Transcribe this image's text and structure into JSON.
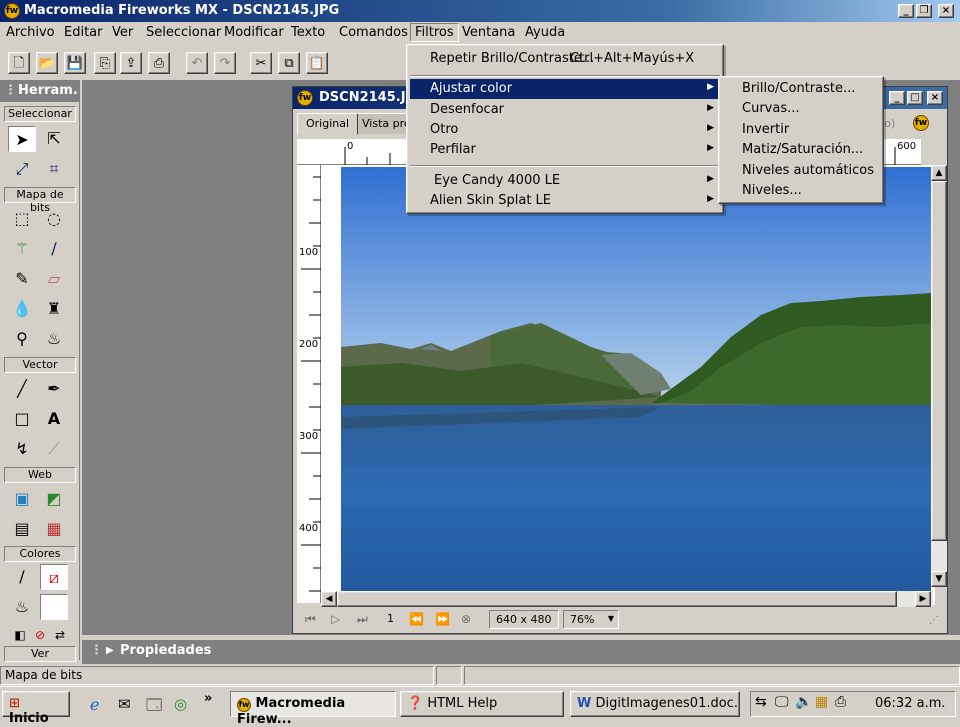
{
  "app": {
    "title": "Macromedia Fireworks MX - DSCN2145.JPG",
    "icon": "fireworks-logo-icon"
  },
  "menubar": [
    "Archivo",
    "Editar",
    "Ver",
    "Seleccionar",
    "Modificar",
    "Texto",
    "Comandos",
    "Filtros",
    "Ventana",
    "Ayuda"
  ],
  "toolbar": {
    "icons": [
      "new-file-icon",
      "open-file-icon",
      "save-icon",
      "import-icon",
      "export-icon",
      "print-icon",
      "undo-icon",
      "redo-icon",
      "cut-icon",
      "copy-icon",
      "paste-icon"
    ]
  },
  "tools_panel": {
    "title": "Herram.",
    "sections": [
      "Seleccionar",
      "Mapa de bits",
      "Vector",
      "Web",
      "Colores",
      "Ver"
    ]
  },
  "document": {
    "title": "DSCN2145.JPG",
    "tabs": [
      "Original",
      "Vista prev"
    ],
    "tab_partial_right": "nto)",
    "hruler_labels": [
      "0",
      "600"
    ],
    "vruler_labels": [
      "100",
      "200",
      "300",
      "400"
    ],
    "page_number": "1",
    "size": "640 x 480",
    "zoom": "76%"
  },
  "filtros_menu": {
    "items": [
      {
        "label": "Repetir Brillo/Contraste...",
        "shortcut": "Ctrl+Alt+Mayús+X"
      },
      {
        "label": "Ajustar color",
        "submenu": true,
        "highlighted": true
      },
      {
        "label": "Desenfocar",
        "submenu": true
      },
      {
        "label": "Otro",
        "submenu": true
      },
      {
        "label": "Perfilar",
        "submenu": true
      },
      {
        "label": "Eye Candy 4000 LE",
        "submenu": true
      },
      {
        "label": "Alien Skin Splat LE",
        "submenu": true
      }
    ]
  },
  "ajustar_submenu": [
    "Brillo/Contraste...",
    "Curvas...",
    "Invertir",
    "Matiz/Saturación...",
    "Niveles automáticos",
    "Niveles..."
  ],
  "properties_panel": {
    "title": "Propiedades"
  },
  "statusbar": {
    "text": "Mapa de bits"
  },
  "taskbar": {
    "start": "Inicio",
    "buttons": [
      "Macromedia Firew...",
      "HTML Help",
      "DigitImagenes01.doc..."
    ],
    "clock": "06:32 a.m."
  }
}
